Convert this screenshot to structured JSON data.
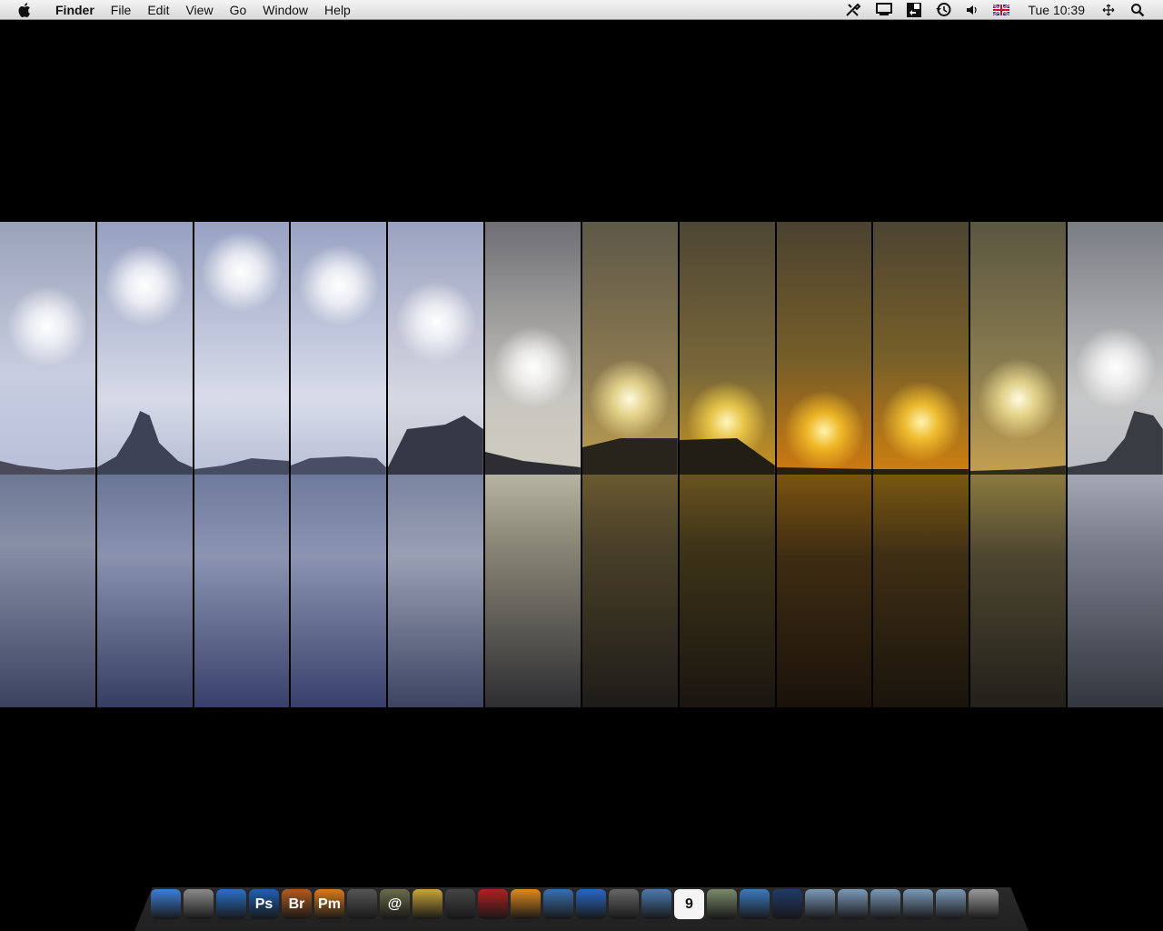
{
  "menubar": {
    "app_name": "Finder",
    "menus": [
      "File",
      "Edit",
      "View",
      "Go",
      "Window",
      "Help"
    ],
    "clock": "Tue 10:39"
  },
  "dock": {
    "items": [
      {
        "name": "finder",
        "label": "",
        "color": "#3d7fd9"
      },
      {
        "name": "system-preferences",
        "label": "",
        "color": "#8a8a8a"
      },
      {
        "name": "time-machine",
        "label": "",
        "color": "#2a6fc9"
      },
      {
        "name": "photoshop",
        "label": "Ps",
        "color": "#1f5fb3"
      },
      {
        "name": "bridge",
        "label": "Br",
        "color": "#b35a1f"
      },
      {
        "name": "photomerge",
        "label": "Pm",
        "color": "#d97a1a"
      },
      {
        "name": "automator",
        "label": "",
        "color": "#555555"
      },
      {
        "name": "mail",
        "label": "@",
        "color": "#6b6b4a"
      },
      {
        "name": "safari",
        "label": "",
        "color": "#c9a53a"
      },
      {
        "name": "imovie",
        "label": "",
        "color": "#444444"
      },
      {
        "name": "front-row",
        "label": "",
        "color": "#b21f1f"
      },
      {
        "name": "quicktime",
        "label": "",
        "color": "#e08a1a"
      },
      {
        "name": "itunes",
        "label": "",
        "color": "#3a6fb0"
      },
      {
        "name": "google-earth",
        "label": "",
        "color": "#2a66c4"
      },
      {
        "name": "script-editor",
        "label": "",
        "color": "#666666"
      },
      {
        "name": "iphoto",
        "label": "",
        "color": "#4a7ab0"
      },
      {
        "name": "ical",
        "label": "9",
        "color": "#eeeeee"
      },
      {
        "name": "preview",
        "label": "",
        "color": "#7a8a6a"
      },
      {
        "name": "network-utility",
        "label": "",
        "color": "#3a7ac0"
      },
      {
        "name": "activity-monitor",
        "label": "",
        "color": "#1f3a6a"
      },
      {
        "name": "applications-folder",
        "label": "",
        "color": "#7a9ab8"
      },
      {
        "name": "documents-folder",
        "label": "",
        "color": "#7a9ab8"
      },
      {
        "name": "utilities-folder",
        "label": "",
        "color": "#7a9ab8"
      },
      {
        "name": "downloads-folder",
        "label": "",
        "color": "#7a9ab8"
      },
      {
        "name": "stack-folder",
        "label": "",
        "color": "#7a9ab8"
      },
      {
        "name": "trash",
        "label": "",
        "color": "#9a9a9a"
      }
    ]
  }
}
